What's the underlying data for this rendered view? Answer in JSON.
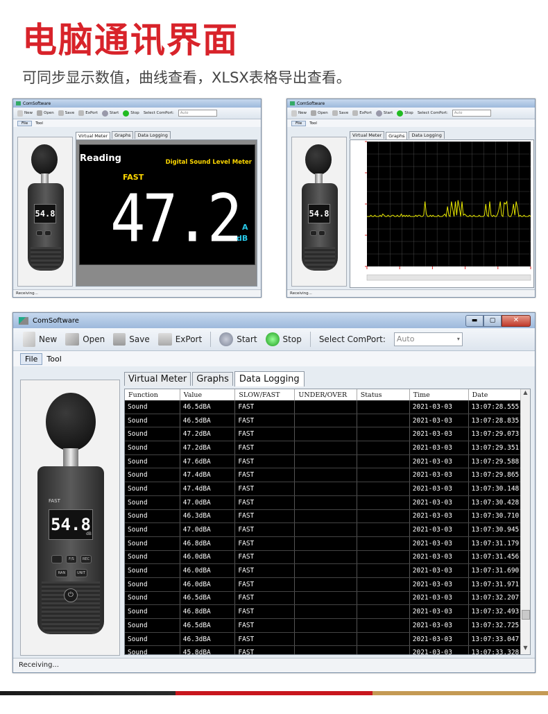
{
  "hero": {
    "title": "电脑通讯界面",
    "subtitle": "可同步显示数值，曲线查看，XLSX表格导出查看。"
  },
  "app": {
    "title": "ComSoftware",
    "toolbar": {
      "new": "New",
      "open": "Open",
      "save": "Save",
      "export": "ExPort",
      "start": "Start",
      "stop": "Stop",
      "comport_label": "Select ComPort:",
      "comport_value": "Auto"
    },
    "menu": [
      "File",
      "Tool"
    ],
    "tabs": [
      "Virtual Meter",
      "Graphs",
      "Data Logging"
    ],
    "status": "Receiving..."
  },
  "meter_device": {
    "reading": "54.8",
    "mode": "FAST",
    "units": "dB",
    "buttons": [
      "",
      "F/S",
      "REC",
      "RAN",
      "UNIT"
    ]
  },
  "virtual_meter": {
    "reading_label": "Reading",
    "device_name": "Digital Sound Level Meter",
    "mode": "FAST",
    "value": "47.2",
    "unit_a": "A",
    "unit_db": "dB"
  },
  "chart_data": {
    "type": "line",
    "title": "",
    "xlabel": "",
    "ylabel": "",
    "grid": true,
    "series": [
      {
        "values": [
          40,
          40,
          40,
          41,
          40,
          40,
          41,
          40,
          40,
          40,
          41,
          40,
          42,
          41,
          40,
          40,
          41,
          40,
          40,
          41,
          41,
          40,
          40,
          41,
          40,
          40,
          42,
          40,
          41,
          40,
          41,
          40,
          41,
          40,
          40,
          40,
          40,
          41,
          40,
          41,
          41,
          40,
          40,
          41,
          52,
          42,
          40,
          40,
          41,
          40,
          41,
          40,
          40,
          40,
          41,
          40,
          40,
          40,
          41,
          42,
          40,
          48,
          41,
          40,
          52,
          46,
          40,
          52,
          41,
          53,
          47,
          40,
          52,
          41,
          42,
          41,
          40,
          40,
          41,
          40,
          40,
          41,
          40,
          40,
          40,
          41,
          40,
          40,
          40,
          41,
          50,
          41,
          40,
          52,
          41,
          40,
          41,
          40,
          40,
          42,
          46,
          52,
          41,
          40,
          51,
          50,
          52,
          41,
          40,
          40,
          43,
          50,
          41,
          52,
          47,
          40,
          41,
          40,
          40,
          41,
          40,
          40,
          40,
          41,
          40
        ]
      }
    ],
    "ylim": [
      0,
      100
    ]
  },
  "data_logging": {
    "columns": [
      "Function",
      "Value",
      "SLOW/FAST",
      "UNDER/OVER",
      "Status",
      "Time",
      "Date"
    ],
    "rows": [
      [
        "Sound",
        "46.5dBA",
        "FAST",
        "",
        "",
        "2021-03-03",
        "13:07:28.555"
      ],
      [
        "Sound",
        "46.5dBA",
        "FAST",
        "",
        "",
        "2021-03-03",
        "13:07:28.835"
      ],
      [
        "Sound",
        "47.2dBA",
        "FAST",
        "",
        "",
        "2021-03-03",
        "13:07:29.073"
      ],
      [
        "Sound",
        "47.2dBA",
        "FAST",
        "",
        "",
        "2021-03-03",
        "13:07:29.351"
      ],
      [
        "Sound",
        "47.6dBA",
        "FAST",
        "",
        "",
        "2021-03-03",
        "13:07:29.588"
      ],
      [
        "Sound",
        "47.4dBA",
        "FAST",
        "",
        "",
        "2021-03-03",
        "13:07:29.865"
      ],
      [
        "Sound",
        "47.4dBA",
        "FAST",
        "",
        "",
        "2021-03-03",
        "13:07:30.148"
      ],
      [
        "Sound",
        "47.0dBA",
        "FAST",
        "",
        "",
        "2021-03-03",
        "13:07:30.428"
      ],
      [
        "Sound",
        "46.3dBA",
        "FAST",
        "",
        "",
        "2021-03-03",
        "13:07:30.710"
      ],
      [
        "Sound",
        "47.0dBA",
        "FAST",
        "",
        "",
        "2021-03-03",
        "13:07:30.945"
      ],
      [
        "Sound",
        "46.8dBA",
        "FAST",
        "",
        "",
        "2021-03-03",
        "13:07:31.179"
      ],
      [
        "Sound",
        "46.0dBA",
        "FAST",
        "",
        "",
        "2021-03-03",
        "13:07:31.456"
      ],
      [
        "Sound",
        "46.0dBA",
        "FAST",
        "",
        "",
        "2021-03-03",
        "13:07:31.690"
      ],
      [
        "Sound",
        "46.0dBA",
        "FAST",
        "",
        "",
        "2021-03-03",
        "13:07:31.971"
      ],
      [
        "Sound",
        "46.5dBA",
        "FAST",
        "",
        "",
        "2021-03-03",
        "13:07:32.207"
      ],
      [
        "Sound",
        "46.8dBA",
        "FAST",
        "",
        "",
        "2021-03-03",
        "13:07:32.493"
      ],
      [
        "Sound",
        "46.5dBA",
        "FAST",
        "",
        "",
        "2021-03-03",
        "13:07:32.725"
      ],
      [
        "Sound",
        "46.3dBA",
        "FAST",
        "",
        "",
        "2021-03-03",
        "13:07:33.047"
      ],
      [
        "Sound",
        "45.8dBA",
        "FAST",
        "",
        "",
        "2021-03-03",
        "13:07:33.328"
      ]
    ]
  },
  "colors": {
    "accent_red": "#d8232a",
    "graph_line": "#e8e800",
    "lcd_text": "#ffffff",
    "highlight_yellow": "#ffd800",
    "unit_cyan": "#28c8e8"
  }
}
